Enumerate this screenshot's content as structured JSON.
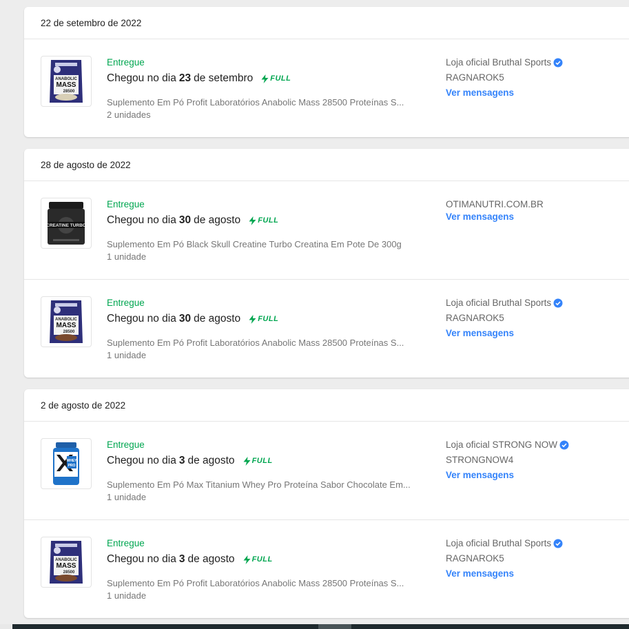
{
  "colors": {
    "green": "#00a650",
    "blue": "#3483fa",
    "badge": "#3483fa"
  },
  "groups": [
    {
      "date": "22 de setembro de 2022",
      "items": [
        {
          "status": "Entregue",
          "arrival_prefix": "Chegou no dia",
          "arrival_day": "23",
          "arrival_suffix": "de setembro",
          "full_label": "FULL",
          "title": "Suplemento Em Pó Profit Laboratórios Anabolic Mass 28500 Proteínas S...",
          "quantity": "2 unidades",
          "seller": "Loja oficial Bruthal Sports",
          "nickname": "RAGNAROK5",
          "messages": "Ver mensagens",
          "product_image": "anabolic-mass-bag",
          "image_text": [
            "ANABOLIC",
            "MASS",
            "28500"
          ]
        }
      ]
    },
    {
      "date": "28 de agosto de 2022",
      "items": [
        {
          "status": "Entregue",
          "arrival_prefix": "Chegou no dia",
          "arrival_day": "30",
          "arrival_suffix": "de agosto",
          "full_label": "FULL",
          "title": "Suplemento Em Pó Black Skull Creatine Turbo Creatina Em Pote De 300g",
          "quantity": "1 unidade",
          "seller": "OTIMANUTRI.COM.BR",
          "messages": "Ver mensagens",
          "product_image": "creatine-turbo-pot",
          "image_text": [
            "CREATINE TURBO"
          ]
        },
        {
          "status": "Entregue",
          "arrival_prefix": "Chegou no dia",
          "arrival_day": "30",
          "arrival_suffix": "de agosto",
          "full_label": "FULL",
          "title": "Suplemento Em Pó Profit Laboratórios Anabolic Mass 28500 Proteínas S...",
          "quantity": "1 unidade",
          "seller": "Loja oficial Bruthal Sports",
          "nickname": "RAGNAROK5",
          "messages": "Ver mensagens",
          "product_image": "anabolic-mass-bag",
          "image_text": [
            "ANABOLIC",
            "MASS",
            "28500"
          ]
        }
      ]
    },
    {
      "date": "2 de agosto de 2022",
      "items": [
        {
          "status": "Entregue",
          "arrival_prefix": "Chegou no dia",
          "arrival_day": "3",
          "arrival_suffix": "de agosto",
          "full_label": "FULL",
          "title": "Suplemento Em Pó Max Titanium Whey Pro Proteína Sabor Chocolate Em...",
          "quantity": "1 unidade",
          "seller": "Loja oficial STRONG NOW",
          "nickname": "STRONGNOW4",
          "messages": "Ver mensagens",
          "product_image": "whey-pro-jar",
          "image_text": [
            "WHEY",
            "PRO"
          ]
        },
        {
          "status": "Entregue",
          "arrival_prefix": "Chegou no dia",
          "arrival_day": "3",
          "arrival_suffix": "de agosto",
          "full_label": "FULL",
          "title": "Suplemento Em Pó Profit Laboratórios Anabolic Mass 28500 Proteínas S...",
          "quantity": "1 unidade",
          "seller": "Loja oficial Bruthal Sports",
          "nickname": "RAGNAROK5",
          "messages": "Ver mensagens",
          "product_image": "anabolic-mass-bag",
          "image_text": [
            "ANABOLIC",
            "MASS",
            "28500"
          ]
        }
      ]
    }
  ]
}
